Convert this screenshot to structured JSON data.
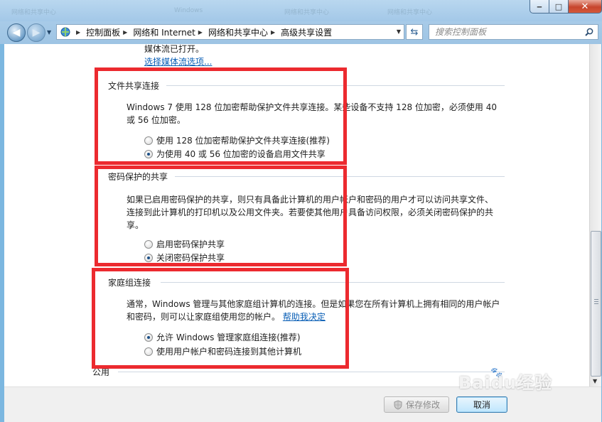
{
  "window": {
    "caption_min": "‒",
    "caption_max": "□",
    "caption_close": "✕",
    "ghost_titles": [
      "网络和共享中心",
      "Windows",
      "网络和共享中心",
      "网络和共享中心",
      "网络和共享中心"
    ]
  },
  "nav": {
    "back_icon": "arrow-left-icon",
    "forward_icon": "arrow-right-icon",
    "breadcrumbs": [
      "控制面板",
      "网络和 Internet",
      "网络和共享中心",
      "高级共享设置"
    ],
    "search_placeholder": "搜索控制面板"
  },
  "top": {
    "media_text": "媒体流已打开。",
    "media_link": "选择媒体流选项..."
  },
  "file_sharing": {
    "title": "文件共享连接",
    "description_line1": "Windows 7 使用 128 位加密帮助保护文件共享连接。某些设备不支持 128 位加密，必须使用 40",
    "description_line2": "或 56 位加密。",
    "options": [
      {
        "label": "使用 128 位加密帮助保护文件共享连接(推荐)",
        "checked": false
      },
      {
        "label": "为使用 40 或 56 位加密的设备启用文件共享",
        "checked": true
      }
    ]
  },
  "password_sharing": {
    "title": "密码保护的共享",
    "description_line1": "如果已启用密码保护的共享，则只有具备此计算机的用户帐户和密码的用户才可以访问共享文件、",
    "description_line2": "连接到此计算机的打印机以及公用文件夹。若要使其他用户具备访问权限，必须关闭密码保护的共",
    "description_line3": "享。",
    "options": [
      {
        "label": "启用密码保护共享",
        "checked": false
      },
      {
        "label": "关闭密码保护共享",
        "checked": true
      }
    ]
  },
  "homegroup": {
    "title": "家庭组连接",
    "description_line1": "通常，Windows 管理与其他家庭组计算机的连接。但是如果您在所有计算机上拥有相同的用户帐户",
    "description_line2": "和密码，则可以让家庭组使用您的帐户。",
    "help_link": "帮助我决定",
    "options": [
      {
        "label": "允许 Windows 管理家庭组连接(推荐)",
        "checked": true
      },
      {
        "label": "使用用户帐户和密码连接到其他计算机",
        "checked": false
      }
    ]
  },
  "public_section": {
    "title": "公用"
  },
  "footer": {
    "save_label": "保存修改",
    "cancel_label": "取消"
  },
  "watermark": {
    "text": "Baidu经验"
  },
  "colors": {
    "highlight": "#ec2a2f",
    "link": "#0a5fb6"
  }
}
